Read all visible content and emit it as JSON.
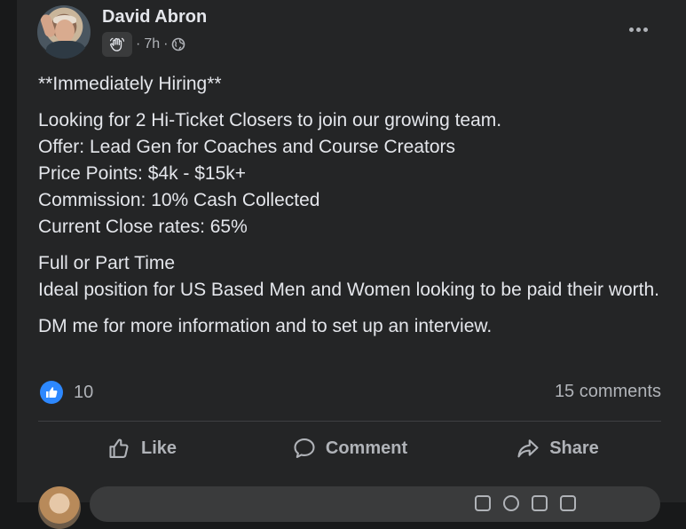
{
  "post": {
    "author": "David Abron",
    "time": "7h",
    "separator": "·",
    "body": {
      "headline": "**Immediately Hiring**",
      "details": [
        "Looking for 2 Hi-Ticket Closers to join our growing team.",
        "Offer: Lead Gen for Coaches and Course Creators",
        "Price Points: $4k - $15k+",
        "Commission: 10% Cash Collected",
        "Current Close rates: 65%"
      ],
      "availability": [
        "Full or Part Time",
        "Ideal position for US Based Men and Women looking to be paid their worth."
      ],
      "cta": "DM me for more information and to set up an interview."
    },
    "reactions": {
      "count": "10",
      "icon": "like-icon",
      "color": "#2d88ff"
    },
    "comments": "15 comments"
  },
  "actions": {
    "like": "Like",
    "comment": "Comment",
    "share": "Share"
  },
  "theme": {
    "background": "#18191a",
    "card": "#242526",
    "text": "#e4e6eb",
    "secondary": "#b0b3b8"
  }
}
